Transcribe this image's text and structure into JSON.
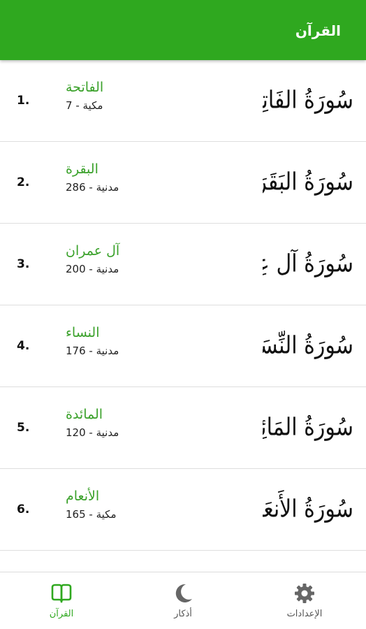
{
  "app_bar": {
    "title": "القرآن"
  },
  "surahs": [
    {
      "number": "1.",
      "name": "الفاتحة",
      "meta": "مكية - 7",
      "calligraphy": "سُورَةُ الفَاتِحَةِ"
    },
    {
      "number": "2.",
      "name": "البقرة",
      "meta": "مدنية - 286",
      "calligraphy": "سُورَةُ البَقَرَةِ"
    },
    {
      "number": "3.",
      "name": "آل عمران",
      "meta": "مدنية - 200",
      "calligraphy": "سُورَةُ آل عِمرَان"
    },
    {
      "number": "4.",
      "name": "النساء",
      "meta": "مدنية - 176",
      "calligraphy": "سُورَةُ النِّسَاءِ"
    },
    {
      "number": "5.",
      "name": "المائدة",
      "meta": "مدنية - 120",
      "calligraphy": "سُورَةُ المَائِدَةِ"
    },
    {
      "number": "6.",
      "name": "الأنعام",
      "meta": "مكية - 165",
      "calligraphy": "سُورَةُ الأَنعَامِ"
    }
  ],
  "bottom_nav": {
    "quran_label": "القرآن",
    "adhkar_label": "أذكار",
    "settings_label": "الإعدادات",
    "active_color": "#2fa81f",
    "inactive_color": "#555555"
  },
  "theme": {
    "primary": "#2fa81f",
    "accent_text": "#3aa12a"
  }
}
